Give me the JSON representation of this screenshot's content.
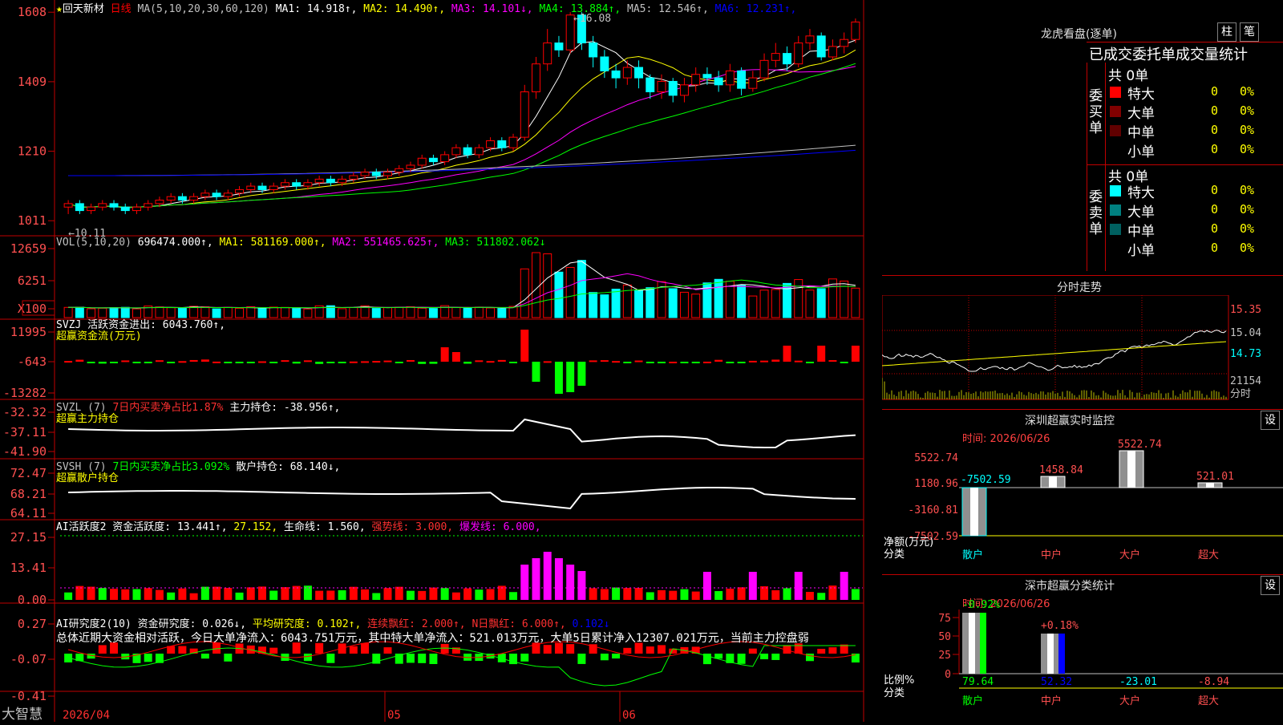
{
  "stock": {
    "name": "回天新材",
    "star": "★",
    "period": "日线",
    "ma_params": "MA(5,10,20,30,60,120)"
  },
  "ma_values": [
    {
      "label": "MA1:",
      "value": "14.918",
      "arrow": "↑",
      "color": "#ffffff"
    },
    {
      "label": "MA2:",
      "value": "14.490",
      "arrow": "↑",
      "color": "#ffff00"
    },
    {
      "label": "MA3:",
      "value": "14.101",
      "arrow": "↓",
      "color": "#ff00ff"
    },
    {
      "label": "MA4:",
      "value": "13.884",
      "arrow": "↑",
      "color": "#00ff00"
    },
    {
      "label": "MA5:",
      "value": "12.546",
      "arrow": "↑",
      "color": "#c0c0c0"
    },
    {
      "label": "MA6:",
      "value": "12.231",
      "arrow": "↑",
      "color": "#0000ff"
    }
  ],
  "price_axis": [
    "1608",
    "1409",
    "1210",
    "1011"
  ],
  "price_annotations": {
    "high": "16.08",
    "low": "10.11"
  },
  "vol": {
    "header": "VOL(5,10,20)",
    "value": "696474.000",
    "ma1": "MA1: 581169.000",
    "ma2": "MA2: 551465.625",
    "ma3": "MA3: 511802.062",
    "axis": [
      "12659",
      "6251",
      "X100"
    ]
  },
  "svzj": {
    "header": "SVZJ  活跃资金进出: 6043.760",
    "subtitle": "超赢资金流(万元)",
    "axis": [
      "11995",
      "-643",
      "-13282"
    ]
  },
  "svzl": {
    "header_a": "SVZL (7)",
    "header_b": "7日内买卖净占比1.87%",
    "header_c": "主力持仓: -38.956",
    "subtitle": "超赢主力持仓",
    "axis": [
      "-32.32",
      "-37.11",
      "-41.90"
    ]
  },
  "svsh": {
    "header_a": "SVSH (7)",
    "header_b": "7日内买卖净占比3.092%",
    "header_c": "散户持仓: 68.140",
    "subtitle": "超赢散户持仓",
    "axis": [
      "72.47",
      "68.21",
      "64.11"
    ]
  },
  "ai1": {
    "header_a": "AI活跃度2 资金活跃度: 13.441",
    "header_b": "27.152,",
    "header_c": "生命线: 1.560,",
    "header_d": "强势线: 3.000,",
    "header_e": "爆发线: 6.000,",
    "axis": [
      "27.15",
      "13.41",
      "0.00"
    ]
  },
  "ai2": {
    "header_a": "AI研究度2(10) 资金研究度: 0.026",
    "header_b": "平均研究度: 0.102",
    "header_c": "连续飘红: 2.000",
    "header_d": "N日飘红: 6.000",
    "header_e": "0.102",
    "summary": "总体近期大资金相对活跃，今日大单净流入：6043.751万元，其中特大单净流入：521.013万元，大单5日累计净入12307.021万元，当前主力控盘弱",
    "axis": [
      "0.27",
      "-0.07",
      "-0.41"
    ]
  },
  "date_axis": {
    "start": "2026/04",
    "m1": "05",
    "m2": "06"
  },
  "brand": "大智慧",
  "right": {
    "lhb_title": "龙虎看盘(逐单)",
    "btn_bar": "柱",
    "btn_pen": "笔",
    "stats_title": "已成交委托单成交量统计",
    "buy_total": "共 0单",
    "sell_total": "共 0单",
    "buy_label": "委买单",
    "sell_label": "委卖单",
    "buy_rows": [
      {
        "name": "特大",
        "count": "0",
        "pct": "0%",
        "color": "#ff0000"
      },
      {
        "name": "大单",
        "count": "0",
        "pct": "0%",
        "color": "#800000"
      },
      {
        "name": "中单",
        "count": "0",
        "pct": "0%",
        "color": "#600000"
      },
      {
        "name": "小单",
        "count": "0",
        "pct": "0%",
        "color": "#000000"
      }
    ],
    "sell_rows": [
      {
        "name": "特大",
        "count": "0",
        "pct": "0%",
        "color": "#00ffff"
      },
      {
        "name": "大单",
        "count": "0",
        "pct": "0%",
        "color": "#008080"
      },
      {
        "name": "中单",
        "count": "0",
        "pct": "0%",
        "color": "#006060"
      },
      {
        "name": "小单",
        "count": "0",
        "pct": "0%",
        "color": "#000000"
      }
    ],
    "intraday_title": "分时走势",
    "intraday_axis": [
      "15.35",
      "15.04",
      "14.73",
      "21154"
    ],
    "intraday_label": "分时",
    "sz_title": "深圳超赢实时监控",
    "sz_btn": "设",
    "sz_time": "时间: 2026/06/26",
    "sz_axis": [
      "5522.74",
      "1180.96",
      "-3160.81",
      "-7502.59"
    ],
    "sz_unit_a": "净额(万元)",
    "sz_unit_b": "分类",
    "sz_cats": [
      "散户",
      "中户",
      "大户",
      "超大"
    ],
    "sz_values": [
      "-7502.59",
      "1458.84",
      "5522.74",
      "521.01"
    ],
    "sc_title": "深市超赢分类统计",
    "sc_btn": "设",
    "sc_time": "时间: 2026/06/26",
    "sc_axis": [
      "75",
      "50",
      "25",
      "0"
    ],
    "sc_unit_a": "比例%",
    "sc_unit_b": "分类",
    "sc_top": [
      "-0.92%",
      "+0.18%"
    ],
    "sc_bottom": [
      "79.64",
      "52.32",
      "-23.01",
      "-8.94"
    ],
    "sc_cats": [
      "散户",
      "中户",
      "大户",
      "超大"
    ]
  },
  "chart_data": [
    {
      "type": "candlestick",
      "title": "回天新材 日线",
      "ylim": [
        10.0,
        16.2
      ],
      "candles": [
        [
          10.5,
          10.6,
          10.3,
          10.7
        ],
        [
          10.6,
          10.4,
          10.3,
          10.7
        ],
        [
          10.4,
          10.5,
          10.3,
          10.6
        ],
        [
          10.5,
          10.6,
          10.4,
          10.7
        ],
        [
          10.6,
          10.5,
          10.4,
          10.7
        ],
        [
          10.5,
          10.4,
          10.3,
          10.6
        ],
        [
          10.4,
          10.5,
          10.3,
          10.6
        ],
        [
          10.5,
          10.6,
          10.4,
          10.7
        ],
        [
          10.6,
          10.7,
          10.5,
          10.8
        ],
        [
          10.7,
          10.8,
          10.6,
          10.9
        ],
        [
          10.8,
          10.7,
          10.6,
          10.9
        ],
        [
          10.7,
          10.8,
          10.6,
          10.9
        ],
        [
          10.8,
          10.9,
          10.7,
          11.0
        ],
        [
          10.9,
          10.8,
          10.7,
          11.0
        ],
        [
          10.8,
          10.9,
          10.7,
          11.0
        ],
        [
          10.9,
          11.0,
          10.8,
          11.1
        ],
        [
          11.0,
          11.1,
          10.9,
          11.2
        ],
        [
          11.1,
          11.0,
          10.9,
          11.2
        ],
        [
          11.0,
          11.1,
          10.9,
          11.2
        ],
        [
          11.1,
          11.2,
          11.0,
          11.3
        ],
        [
          11.2,
          11.1,
          11.0,
          11.3
        ],
        [
          11.1,
          11.2,
          11.0,
          11.3
        ],
        [
          11.2,
          11.3,
          11.1,
          11.4
        ],
        [
          11.3,
          11.2,
          11.1,
          11.4
        ],
        [
          11.2,
          11.3,
          11.1,
          11.4
        ],
        [
          11.3,
          11.4,
          11.2,
          11.5
        ],
        [
          11.4,
          11.5,
          11.3,
          11.6
        ],
        [
          11.5,
          11.4,
          11.3,
          11.6
        ],
        [
          11.4,
          11.5,
          11.3,
          11.6
        ],
        [
          11.5,
          11.6,
          11.4,
          11.7
        ],
        [
          11.6,
          11.7,
          11.5,
          11.8
        ],
        [
          11.7,
          11.9,
          11.6,
          12.0
        ],
        [
          11.9,
          11.8,
          11.7,
          12.0
        ],
        [
          11.8,
          12.0,
          11.7,
          12.1
        ],
        [
          12.0,
          12.2,
          11.9,
          12.3
        ],
        [
          12.2,
          12.0,
          11.9,
          12.3
        ],
        [
          12.0,
          12.2,
          11.9,
          12.3
        ],
        [
          12.2,
          12.4,
          12.1,
          12.5
        ],
        [
          12.4,
          12.2,
          12.1,
          12.5
        ],
        [
          12.2,
          12.5,
          12.1,
          12.6
        ],
        [
          12.5,
          13.8,
          12.4,
          14.0
        ],
        [
          13.8,
          14.6,
          13.6,
          14.8
        ],
        [
          14.6,
          15.2,
          14.4,
          15.6
        ],
        [
          15.2,
          15.0,
          14.8,
          15.4
        ],
        [
          15.0,
          16.0,
          14.9,
          16.08
        ],
        [
          16.0,
          15.2,
          15.0,
          16.08
        ],
        [
          15.2,
          14.8,
          14.5,
          15.4
        ],
        [
          14.8,
          14.4,
          14.2,
          15.0
        ],
        [
          14.4,
          14.2,
          13.9,
          14.6
        ],
        [
          14.2,
          14.5,
          14.0,
          14.7
        ],
        [
          14.5,
          14.2,
          13.9,
          14.7
        ],
        [
          14.2,
          13.8,
          13.6,
          14.3
        ],
        [
          13.8,
          14.1,
          13.6,
          14.3
        ],
        [
          14.1,
          13.7,
          13.5,
          14.2
        ],
        [
          13.7,
          14.0,
          13.5,
          14.2
        ],
        [
          14.0,
          14.3,
          13.8,
          14.5
        ],
        [
          14.3,
          14.2,
          14.0,
          14.5
        ],
        [
          14.2,
          14.0,
          13.8,
          14.4
        ],
        [
          14.0,
          14.4,
          13.8,
          14.6
        ],
        [
          14.4,
          13.9,
          13.7,
          14.5
        ],
        [
          13.9,
          14.2,
          13.8,
          14.4
        ],
        [
          14.2,
          14.7,
          14.1,
          14.9
        ],
        [
          14.7,
          14.9,
          14.5,
          15.2
        ],
        [
          14.9,
          14.6,
          14.4,
          15.1
        ],
        [
          14.6,
          15.2,
          14.5,
          15.4
        ],
        [
          15.2,
          15.4,
          15.0,
          15.6
        ],
        [
          15.4,
          14.8,
          14.7,
          15.5
        ],
        [
          14.8,
          15.1,
          14.7,
          15.3
        ],
        [
          15.1,
          15.3,
          14.9,
          15.5
        ],
        [
          15.3,
          15.8,
          15.2,
          15.9
        ]
      ]
    }
  ]
}
